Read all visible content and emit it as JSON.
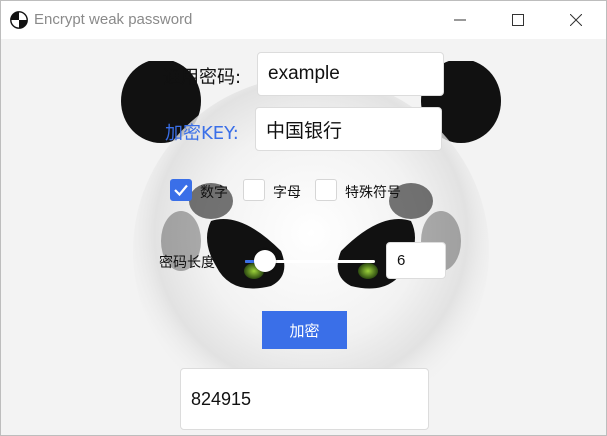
{
  "window": {
    "title": "Encrypt weak password",
    "icon": "panda-circle-icon",
    "controls": [
      "minimize-icon",
      "maximize-icon",
      "close-icon"
    ]
  },
  "form": {
    "general_password_label": "通用密码:",
    "general_password_value": "example",
    "key_label": "加密KEY:",
    "key_value": "中国银行"
  },
  "options": [
    {
      "label": "数字",
      "checked": true
    },
    {
      "label": "字母",
      "checked": false
    },
    {
      "label": "特殊符号",
      "checked": false
    }
  ],
  "length": {
    "label": "密码长度",
    "value": "6",
    "slider_fraction": 0.15
  },
  "encrypt_button": "加密",
  "result": "824915",
  "colors": {
    "accent": "#3a6fe8",
    "background": "#f3f3f3"
  }
}
